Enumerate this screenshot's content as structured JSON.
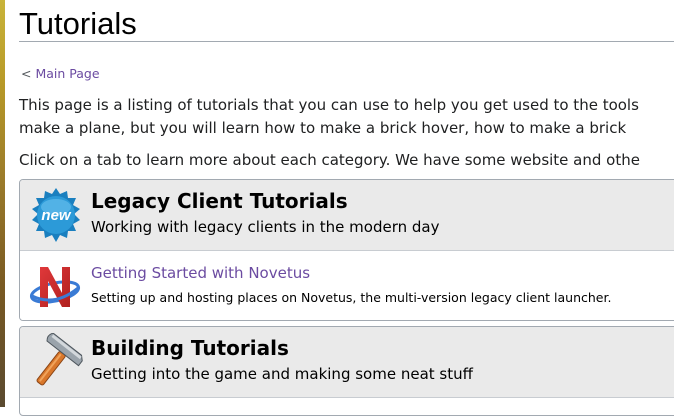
{
  "page": {
    "title": "Tutorials",
    "back_prefix": "< ",
    "back_link": "Main Page",
    "intro_line1": "This page is a listing of tutorials that you can use to help you get used to the tools",
    "intro_line2": "make a plane, but you will learn how to make a brick hover, how to make a brick",
    "intro_line3": "Click on a tab to learn more about each category. We have some website and othe"
  },
  "categories": [
    {
      "icon": "new-badge-icon",
      "title": "Legacy Client Tutorials",
      "subtitle": "Working with legacy clients in the modern day",
      "entries": [
        {
          "icon": "novetus-logo-icon",
          "link": "Getting Started with Novetus",
          "description": "Setting up and hosting places on Novetus, the multi-version legacy client launcher."
        }
      ]
    },
    {
      "icon": "hammer-icon",
      "title": "Building Tutorials",
      "subtitle": "Getting into the game and making some neat stuff"
    }
  ],
  "colors": {
    "link": "#6b4ba1",
    "panel_header_bg": "#eaeaea",
    "border": "#a2a9b1"
  }
}
